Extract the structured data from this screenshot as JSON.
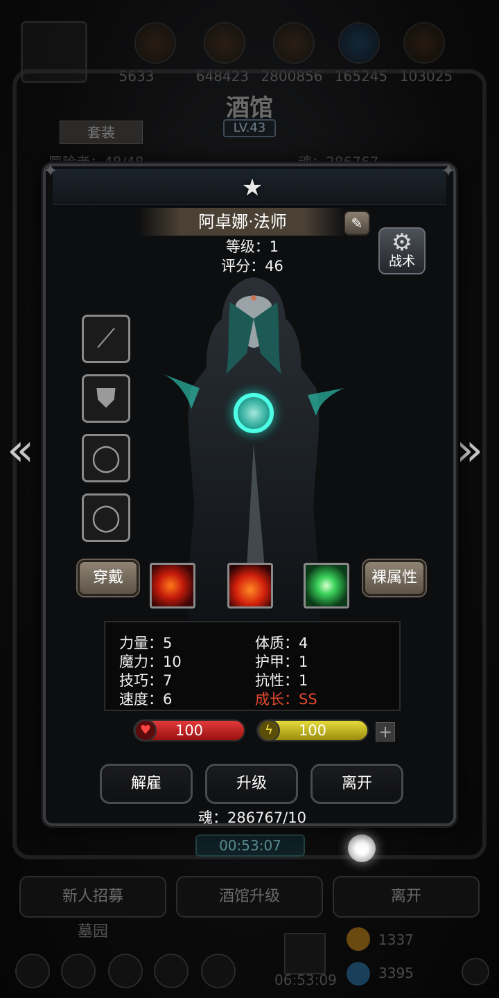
{
  "background": {
    "resources": [
      "5633",
      "648423",
      "2800856",
      "165245",
      "103025"
    ],
    "title": "酒馆",
    "level": "LV.43",
    "tab": "套装",
    "count": "冒险者：48/48",
    "soul": "魂：286767",
    "timer": "00:53:07",
    "buttons": [
      "新人招募",
      "酒馆升级",
      "离开"
    ],
    "grave_label": "墓园",
    "gift_timer": "06:53:09",
    "coins": [
      "1337",
      "3395"
    ]
  },
  "dialog": {
    "name": "阿卓娜·法师",
    "edit_icon": "✎",
    "level": "等级：1",
    "score": "评分：46",
    "tactics": "战术",
    "equip_slots": [
      "staff-icon",
      "armor-icon",
      "ring-icon",
      "ring-icon"
    ],
    "wear_button": "穿戴",
    "base_attr_button": "裸属性",
    "skills": [
      "fire-skill",
      "flame-skill",
      "crystal-skill"
    ],
    "stats": {
      "strength": "力量：5",
      "constitution": "体质：4",
      "magic": "魔力：10",
      "armor": "护甲：1",
      "skill": "技巧：7",
      "resistance": "抗性：1",
      "speed": "速度：6",
      "growth": "成长：SS"
    },
    "hp": "100",
    "energy": "100",
    "actions": [
      "解雇",
      "升级",
      "离开"
    ],
    "soul_cost": "魂：286767/10"
  },
  "colors": {
    "growth": "#e5492f",
    "hp": "#c81c1c",
    "energy": "#c9b91b"
  }
}
